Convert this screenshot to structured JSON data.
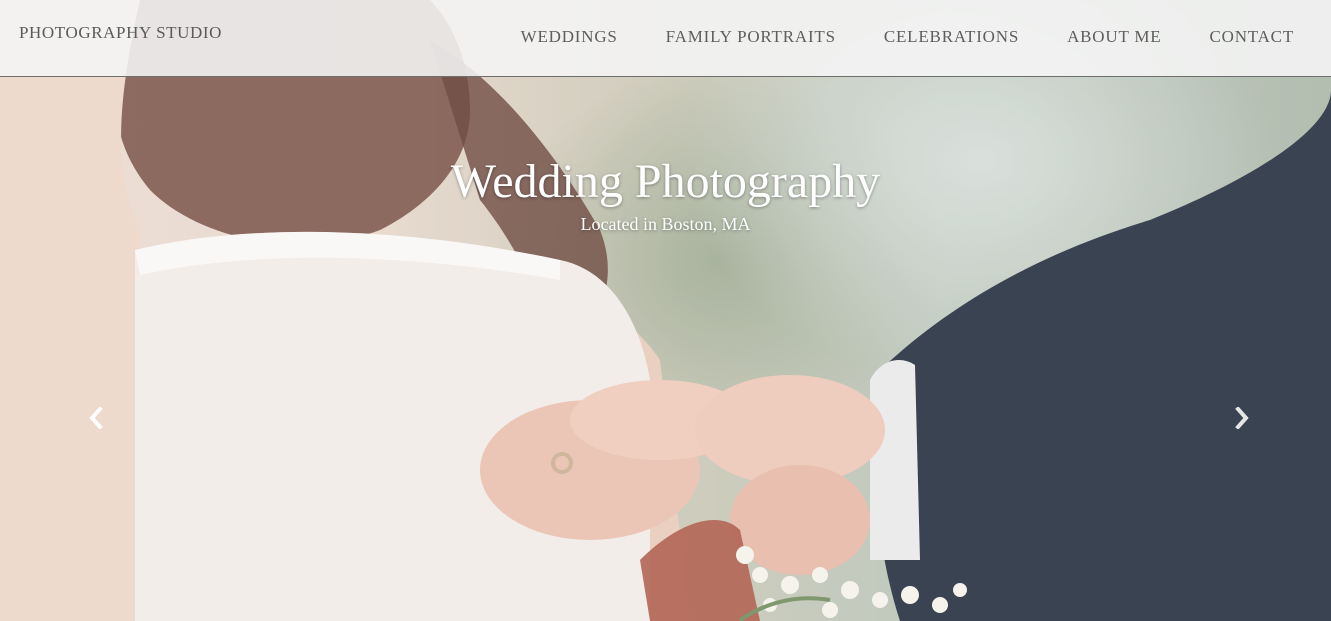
{
  "navbar": {
    "brand": "PHOTOGRAPHY STUDIO",
    "links": [
      {
        "label": "WEDDINGS"
      },
      {
        "label": "FAMILY PORTRAITS"
      },
      {
        "label": "CELEBRATIONS"
      },
      {
        "label": "ABOUT ME"
      },
      {
        "label": "CONTACT"
      }
    ]
  },
  "hero": {
    "image_description_icon": "wedding-ring-photo",
    "title": "Wedding Photography",
    "subtitle": "Located in Boston, MA"
  },
  "carousel": {
    "prev_icon": "chevron-left-icon",
    "next_icon": "chevron-right-icon"
  },
  "colors": {
    "navbar_bg": "#f5f5f5",
    "nav_text": "#5e5e5e",
    "caption_text": "#ffffff"
  }
}
